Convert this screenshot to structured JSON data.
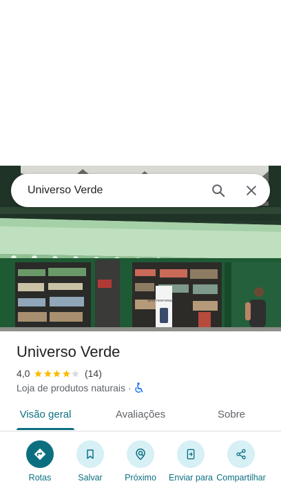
{
  "search": {
    "query": "Universo Verde"
  },
  "hero": {
    "sign_text": "MAIS PERFORMANCE"
  },
  "place": {
    "name": "Universo Verde",
    "rating": "4,0",
    "rating_value": 4.0,
    "stars_filled": 4,
    "stars_total": 5,
    "review_count": "(14)",
    "category": "Loja de produtos naturais",
    "separator": "·",
    "accessibility_icon": "wheelchair-accessible-icon"
  },
  "tabs": [
    {
      "label": "Visão geral",
      "active": true
    },
    {
      "label": "Avaliações",
      "active": false
    },
    {
      "label": "Sobre",
      "active": false
    }
  ],
  "actions": [
    {
      "label": "Rotas",
      "icon": "directions-icon"
    },
    {
      "label": "Salvar",
      "icon": "bookmark-icon"
    },
    {
      "label": "Próximo",
      "icon": "nearby-icon"
    },
    {
      "label": "Enviar para",
      "icon": "send-to-phone-icon"
    },
    {
      "label": "Compartilhar",
      "icon": "share-icon"
    }
  ],
  "colors": {
    "accent": "#0b6f80",
    "action_bg": "#d6f0f5",
    "star": "#fbbc04",
    "star_empty": "#dadce0",
    "accessibility": "#1a73e8"
  }
}
